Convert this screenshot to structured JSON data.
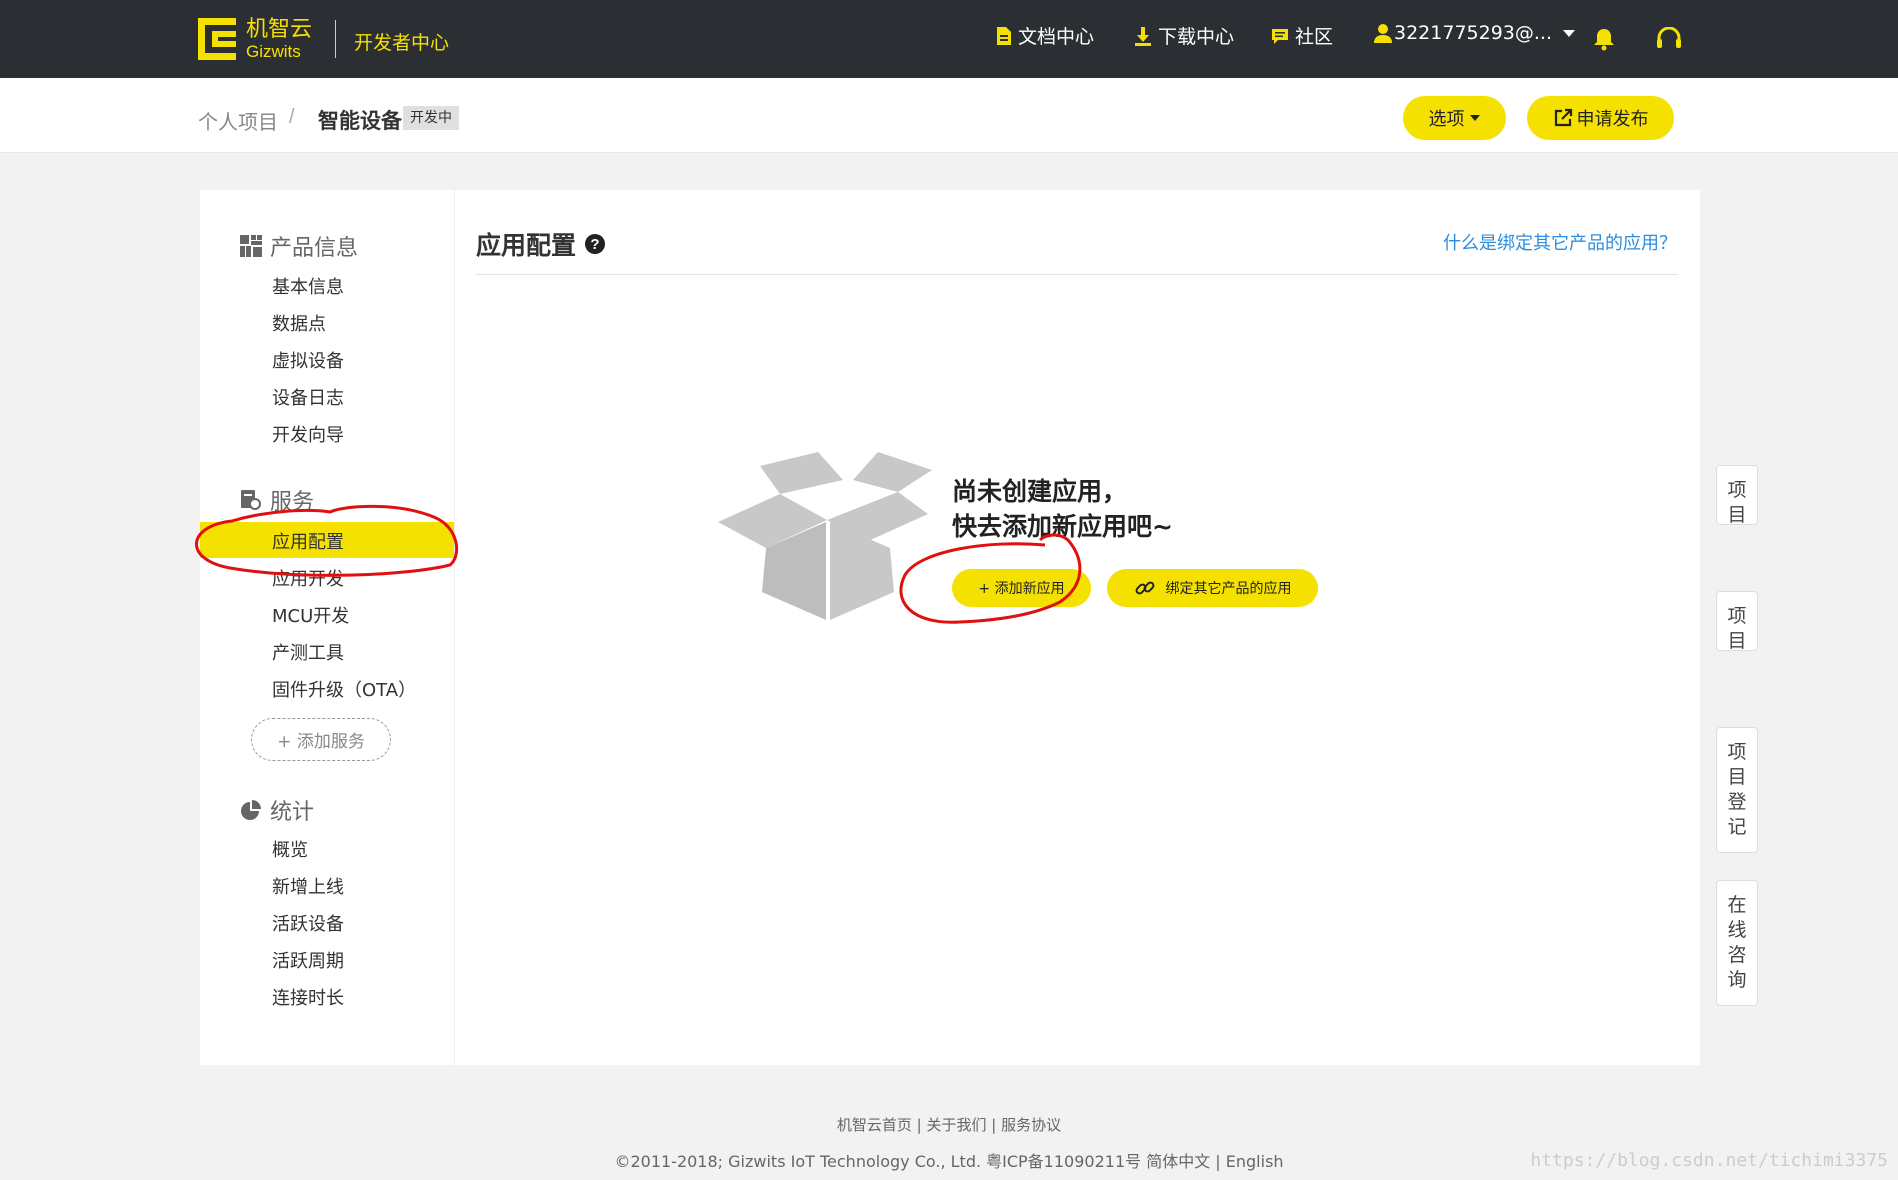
{
  "header": {
    "logo_cn": "机智云",
    "logo_en": "Gizwits",
    "dev_center": "开发者中心",
    "nav": [
      "文档中心",
      "下载中心",
      "社区"
    ],
    "user": "3221775293@...",
    "icons": [
      "document-icon",
      "download-icon",
      "chat-icon",
      "user-icon",
      "bell-icon",
      "headset-icon"
    ]
  },
  "breadcrumb": {
    "parent": "个人项目",
    "sep": "/",
    "current": "智能设备",
    "badge": "开发中"
  },
  "actions": {
    "options": "选项",
    "publish": "申请发布"
  },
  "sidebar": {
    "product_title": "产品信息",
    "product_items": [
      "基本信息",
      "数据点",
      "虚拟设备",
      "设备日志",
      "开发向导"
    ],
    "service_title": "服务",
    "service_items": [
      "应用配置",
      "应用开发",
      "MCU开发",
      "产测工具",
      "固件升级（OTA）"
    ],
    "add_service": "+ 添加服务",
    "stats_title": "统计",
    "stats_items": [
      "概览",
      "新增上线",
      "活跃设备",
      "活跃周期",
      "连接时长"
    ],
    "active_item": "应用配置"
  },
  "main": {
    "title": "应用配置",
    "help_link": "什么是绑定其它产品的应用？",
    "empty_line1": "尚未创建应用，",
    "empty_line2": "快去添加新应用吧~",
    "add_app": "+ 添加新应用",
    "bind_app": "绑定其它产品的应用"
  },
  "float_buttons": [
    "项目",
    "项目",
    "项目登记",
    "在线咨询"
  ],
  "footer": {
    "links": "机智云首页 | 关于我们 | 服务协议",
    "copyright": "©2011-2018; Gizwits IoT Technology Co., Ltd. 粤ICP备11090211号 简体中文 | English"
  },
  "watermark": "https://blog.csdn.net/tichimi3375",
  "colors": {
    "accent": "#f5e100",
    "topbar": "#2b2f33",
    "link": "#2b8ee0",
    "annotation": "#e01010"
  }
}
